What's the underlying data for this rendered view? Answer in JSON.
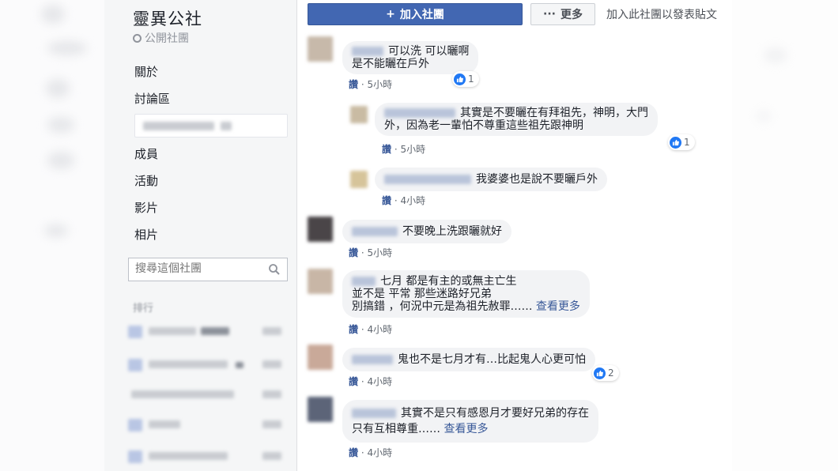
{
  "group": {
    "title": "靈異公社",
    "privacy": "公開社團"
  },
  "sidebar": {
    "items": [
      {
        "label": "關於"
      },
      {
        "label": "討論區"
      },
      {
        "label": "成員"
      },
      {
        "label": "活動"
      },
      {
        "label": "影片"
      },
      {
        "label": "相片"
      }
    ],
    "search": {
      "placeholder": "搜尋這個社團"
    },
    "sort_label": "排行"
  },
  "toolbar": {
    "join_label": "加入社團",
    "more_label": "更多",
    "join_hint": "加入此社團以發表貼文"
  },
  "comments": [
    {
      "lines": [
        "可以洗 可以曬啊",
        "是不能曬在戶外"
      ],
      "like": "讚",
      "time": "5小時",
      "reactions": "1"
    },
    {
      "lines": [
        "其實是不要曬在有拜祖先，神明，大門",
        "外，因為老一輩怕不尊重這些祖先跟神明"
      ],
      "like": "讚",
      "time": "5小時",
      "reactions": "1"
    },
    {
      "lines": [
        "我婆婆也是說不要曬戶外"
      ],
      "like": "讚",
      "time": "4小時"
    },
    {
      "lines": [
        "不要晚上洗跟曬就好"
      ],
      "like": "讚",
      "time": "5小時"
    },
    {
      "lines": [
        "七月 都是有主的或無主亡生",
        "並不是 平常 那些迷路好兄弟",
        "別搞錯 ，何況中元是為祖先赦罪……"
      ],
      "see_more": "查看更多",
      "like": "讚",
      "time": "4小時"
    },
    {
      "lines": [
        "鬼也不是七月才有…比起鬼人心更可怕"
      ],
      "like": "讚",
      "time": "4小時",
      "reactions": "2"
    },
    {
      "lines": [
        "其實不是只有感恩月才要好兄弟的存在",
        "只有互相尊重……"
      ],
      "see_more": "查看更多",
      "like": "讚",
      "time": "4小時"
    }
  ],
  "colors": {
    "brand": "#4267b2",
    "link": "#385898",
    "bubble": "#f2f3f5",
    "sidebar": "#f5f6f7"
  }
}
